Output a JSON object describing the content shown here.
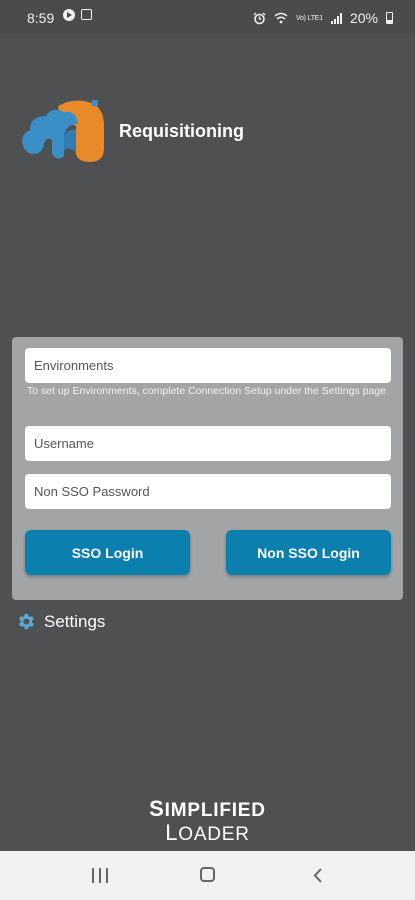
{
  "status_bar": {
    "time": "8:59",
    "network_label": "Vo) LTE1",
    "battery": "20%"
  },
  "app": {
    "title": "Requisitioning"
  },
  "login": {
    "environments_placeholder": "Environments",
    "environments_hint": "To set up Environments, complete Connection Setup under the Settings page",
    "username_placeholder": "Username",
    "password_placeholder": "Non SSO Password",
    "sso_button": "SSO Login",
    "non_sso_button": "Non SSO Login"
  },
  "settings": {
    "label": "Settings"
  },
  "brand": {
    "line1_initial": "S",
    "line1_rest": "IMPLIFIED",
    "line2_initial": "L",
    "line2_rest": "OADER"
  },
  "colors": {
    "background": "#4f5052",
    "panel": "#a3a4a6",
    "button": "#0b7fae",
    "gear": "#5aa9d6",
    "logo_blue": "#3a8fc7",
    "logo_orange": "#e8892a"
  },
  "icons": {
    "status_left": [
      "play-circle-icon",
      "gallery-icon"
    ],
    "status_right": [
      "alarm-icon",
      "wifi-icon",
      "signal-icon",
      "battery-icon"
    ],
    "settings": "gear-icon",
    "nav": [
      "recent-apps-icon",
      "home-icon",
      "back-icon"
    ]
  }
}
